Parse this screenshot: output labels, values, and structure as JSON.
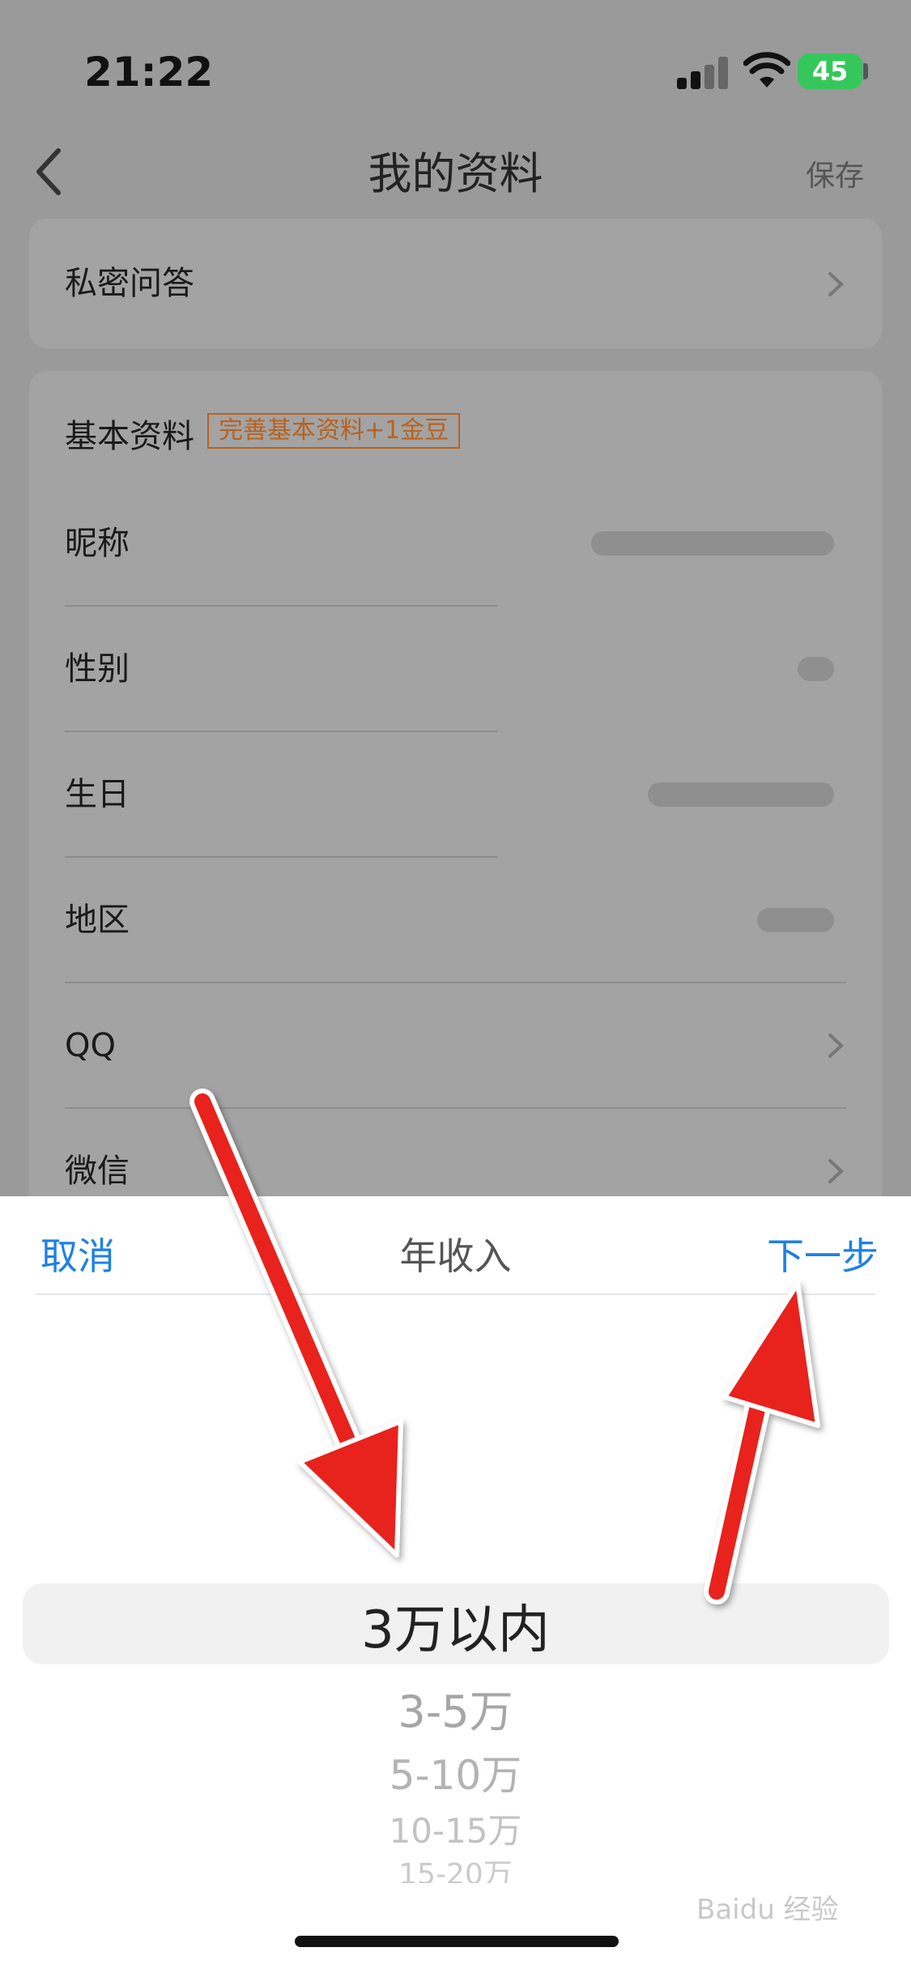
{
  "status_bar": {
    "time": "21:22",
    "battery": "45"
  },
  "nav": {
    "title": "我的资料",
    "save_label": "保存"
  },
  "privacy_card": {
    "qa_label": "私密问答"
  },
  "basic_card": {
    "heading": "基本资料",
    "badge": "完善基本资料+1金豆",
    "rows": [
      {
        "label": "昵称"
      },
      {
        "label": "性别"
      },
      {
        "label": "生日"
      },
      {
        "label": "地区"
      },
      {
        "label": "QQ"
      },
      {
        "label": "微信"
      }
    ]
  },
  "sheet": {
    "cancel_label": "取消",
    "title": "年收入",
    "next_label": "下一步",
    "options": [
      "3万以内",
      "3-5万",
      "5-10万",
      "10-15万",
      "15-20万"
    ],
    "selected": "3万以内"
  },
  "watermark": "Baidu 经验",
  "colors": {
    "accent": "#1d80e6",
    "badge": "#b8621f",
    "annotation_arrow": "#e8201f"
  }
}
